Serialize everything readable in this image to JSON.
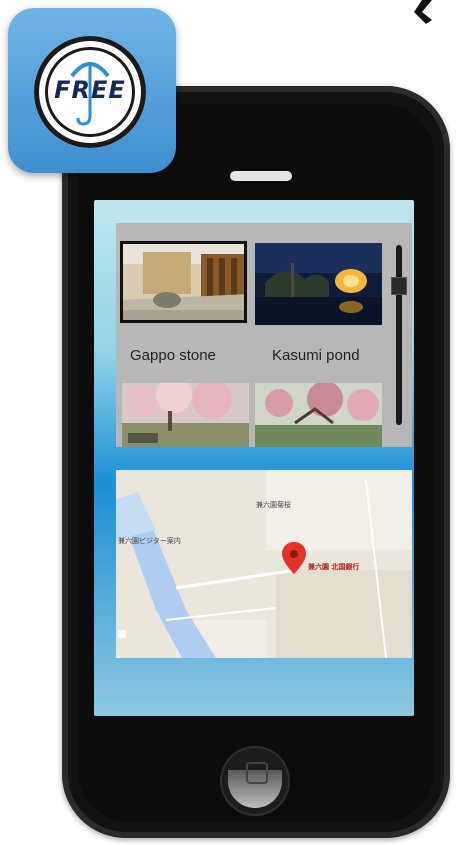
{
  "badge": {
    "text": "FREE",
    "icon": "umbrella-icon"
  },
  "gallery": {
    "items": [
      {
        "caption": "Gappo stone",
        "selected": true
      },
      {
        "caption": "Kasumi pond",
        "selected": false
      },
      {
        "caption": "",
        "selected": false
      },
      {
        "caption": "",
        "selected": false
      }
    ],
    "scroll_position": 0.2
  },
  "map": {
    "labels": {
      "top_place": "兼六園菊桜",
      "left_place": "兼六園ビジター案内",
      "marker_place": "兼六園 北国銀行"
    },
    "marker_color": "#e2332b"
  },
  "colors": {
    "badge_blue": "#4a97d6",
    "screen_top": "#bfe7ef",
    "screen_mid": "#1a8fd6",
    "map_river": "#aecdf0"
  }
}
